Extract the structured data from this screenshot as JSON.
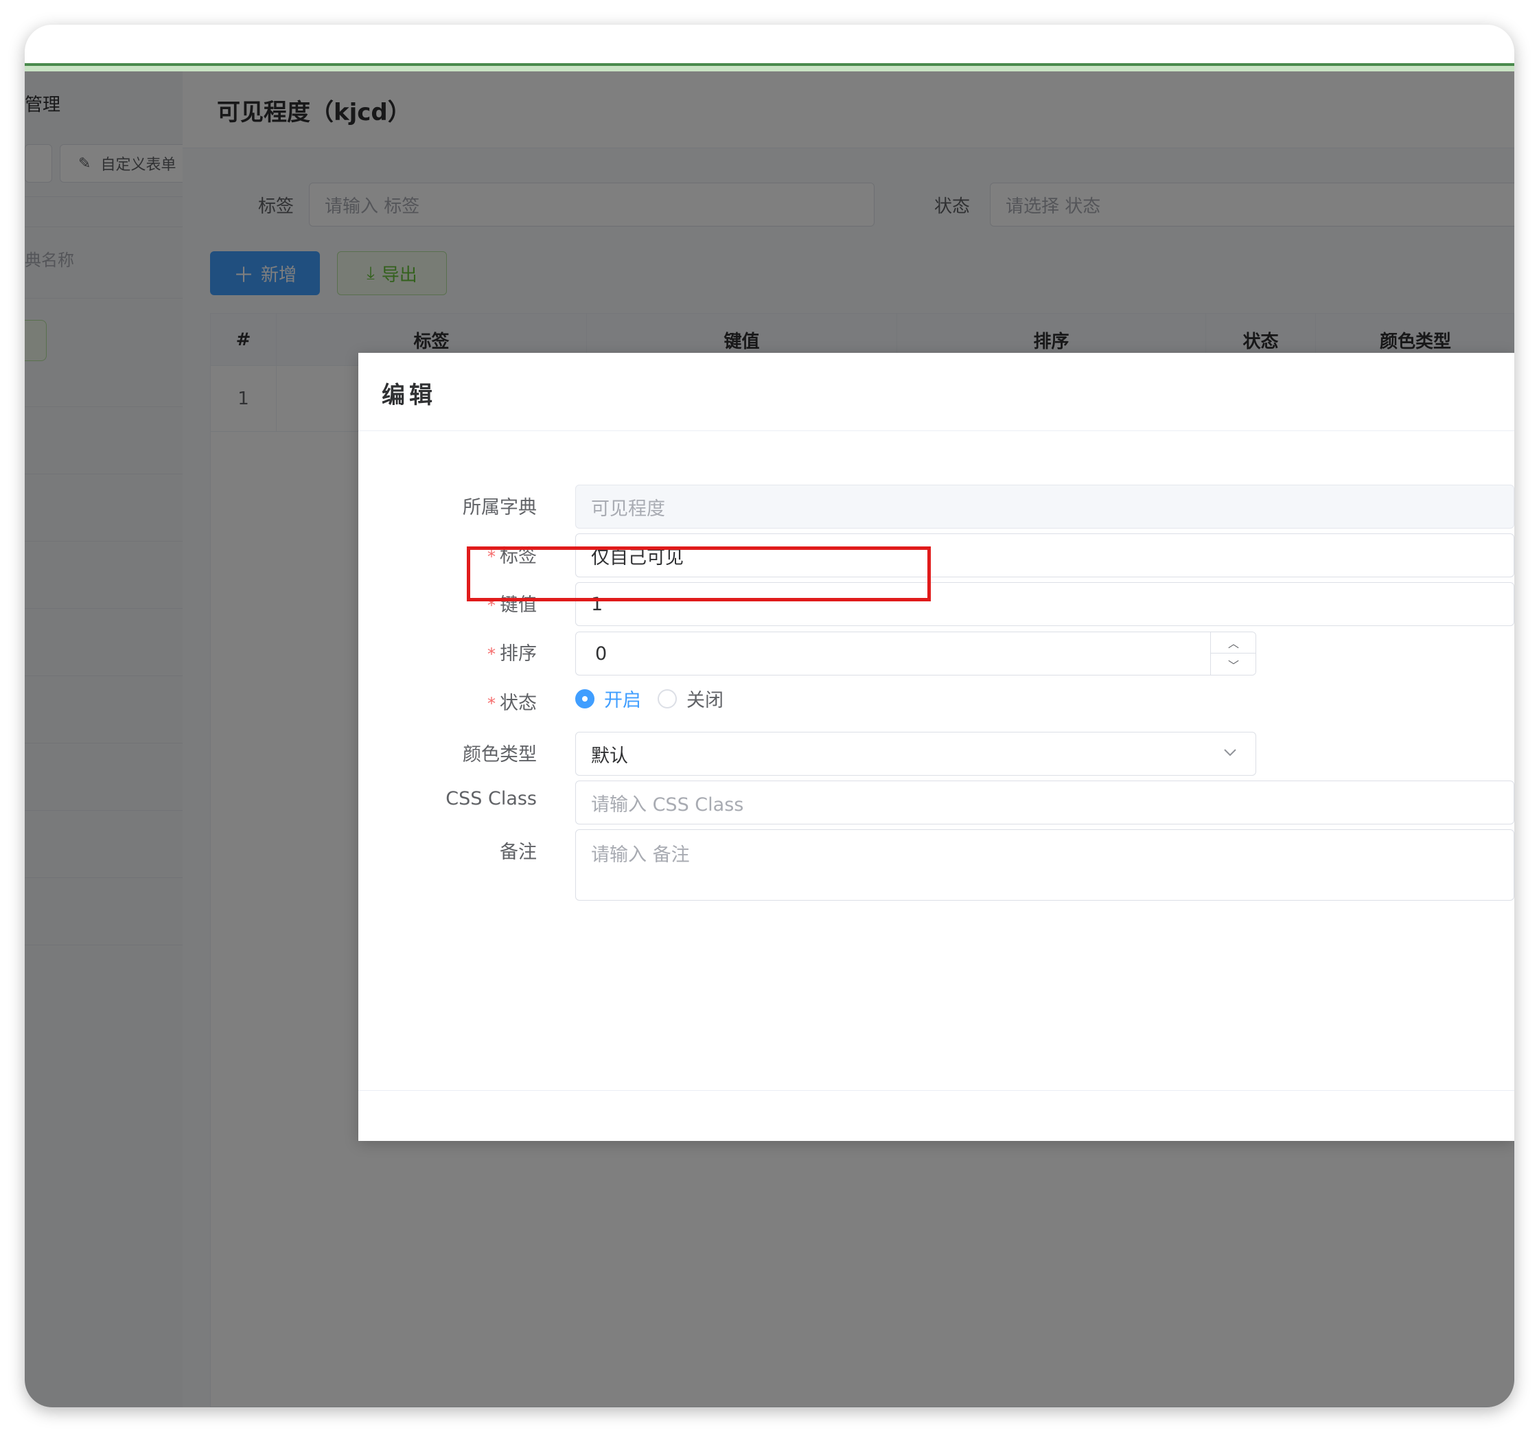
{
  "sidebar": {
    "title": "管理",
    "tab_label": "自定义表单",
    "search_placeholder": "典名称"
  },
  "header": {
    "title": "可见程度（kjcd）"
  },
  "filters": {
    "label_label": "标签",
    "label_placeholder": "请输入 标签",
    "status_label": "状态",
    "status_placeholder": "请选择 状态"
  },
  "toolbar": {
    "add_label": "新增",
    "export_label": "导出"
  },
  "table": {
    "columns": [
      "#",
      "标签",
      "键值",
      "排序",
      "状态",
      "颜色类型"
    ],
    "rows": [
      {
        "index": "1"
      }
    ]
  },
  "dialog": {
    "title": "编辑",
    "fields": {
      "dict": {
        "label": "所属字典",
        "value": "可见程度"
      },
      "label": {
        "label": "标签",
        "value": "仅自己可见"
      },
      "key": {
        "label": "键值",
        "value": "1"
      },
      "sort": {
        "label": "排序",
        "value": "0"
      },
      "status": {
        "label": "状态",
        "options": [
          "开启",
          "关闭"
        ],
        "selected": "开启"
      },
      "color": {
        "label": "颜色类型",
        "value": "默认"
      },
      "css": {
        "label": "CSS Class",
        "placeholder": "请输入 CSS Class"
      },
      "remark": {
        "label": "备注",
        "placeholder": "请输入 备注"
      }
    }
  },
  "colors": {
    "primary": "#409eff",
    "success": "#67c23a",
    "danger": "#f56c6c",
    "highlight": "#e01b1b"
  },
  "icons": {
    "add": "plus-icon",
    "export": "download-icon",
    "tab": "edit-icon",
    "select": "chevron-down-icon"
  }
}
